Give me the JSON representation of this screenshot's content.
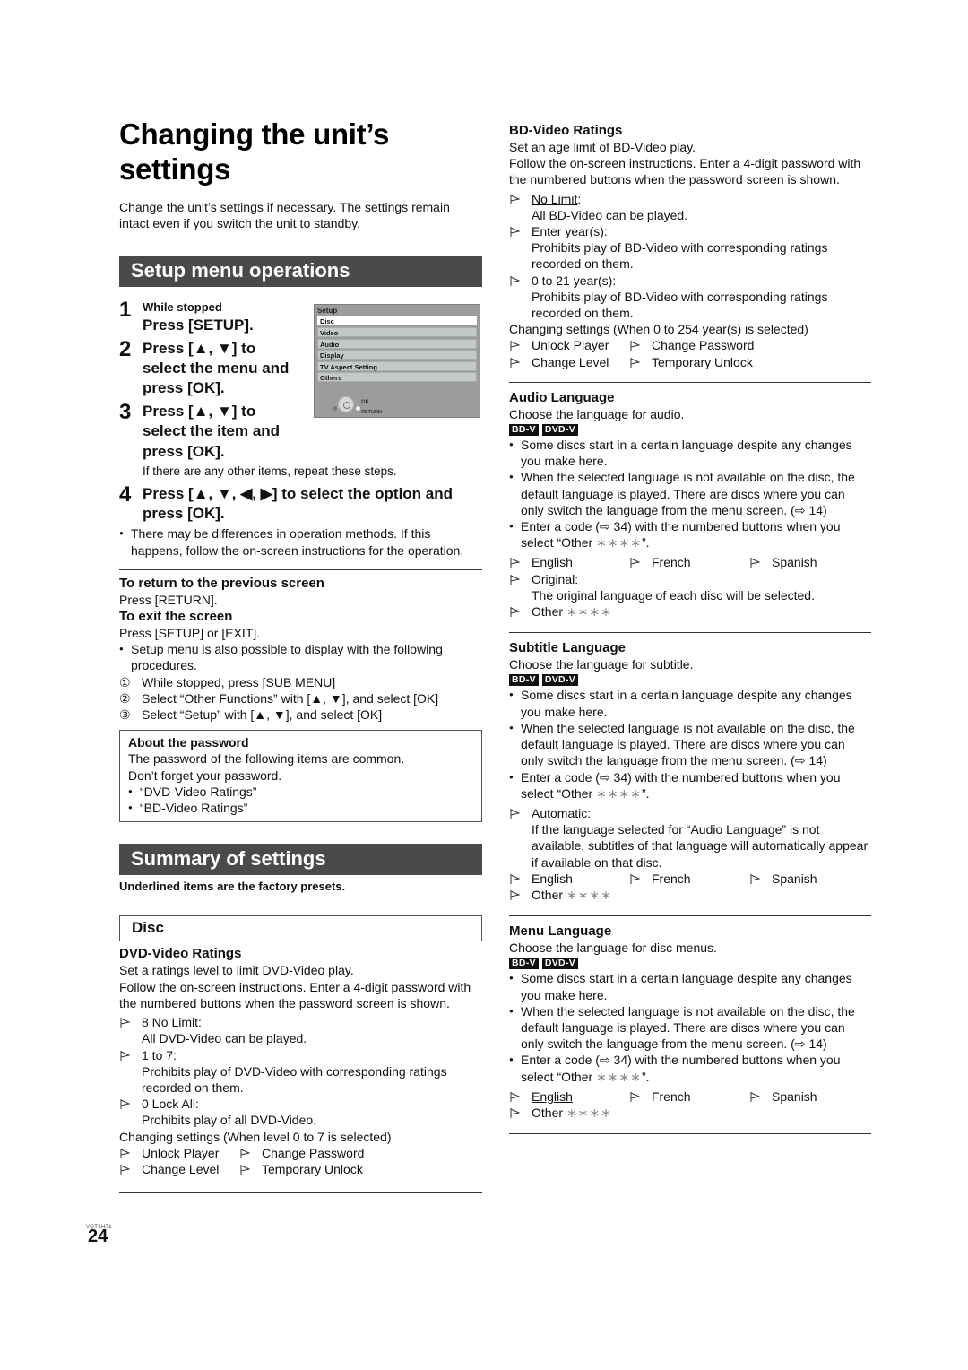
{
  "page": {
    "title_line1": "Changing the unit’s",
    "title_line2": "settings",
    "intro": "Change the unit’s settings if necessary. The settings remain intact even if you switch the unit to standby.",
    "doc_code": "VQT2H71",
    "page_number": "24"
  },
  "setup_ops": {
    "heading": "Setup menu operations",
    "step1": {
      "num": "1",
      "condition": "While stopped",
      "action": "Press [SETUP]."
    },
    "step2": {
      "num": "2",
      "line1": "Press [▲, ▼] to",
      "line2": "select the menu and",
      "line3": "press [OK]."
    },
    "step3": {
      "num": "3",
      "line1": "Press [▲, ▼] to",
      "line2": "select the item and",
      "line3": "press [OK].",
      "note": "If there are any other items, repeat these steps."
    },
    "step4": {
      "num": "4",
      "line1": "Press [▲, ▼, ◀, ▶] to select the option and",
      "line2": "press [OK].",
      "note": "There may be differences in operation methods. If this happens, follow the on-screen instructions for the operation."
    },
    "osd": {
      "title": "Setup",
      "items": [
        "Disc",
        "Video",
        "Audio",
        "Display",
        "TV Aspect Setting",
        "Others"
      ],
      "selected": "Disc",
      "ok_label": "OK",
      "return_label": "RETURN"
    },
    "return_heading": "To return to the previous screen",
    "return_text": "Press [RETURN].",
    "exit_heading": "To exit the screen",
    "exit_text": "Press [SETUP] or [EXIT].",
    "alt_note": "Setup menu is also possible to display with the following procedures.",
    "alt_steps": [
      {
        "mark": "①",
        "text": "While stopped, press [SUB MENU]"
      },
      {
        "mark": "②",
        "text": "Select “Other Functions” with [▲, ▼], and select [OK]"
      },
      {
        "mark": "③",
        "text": "Select “Setup” with [▲, ▼], and select [OK]"
      }
    ],
    "password_box": {
      "heading": "About the password",
      "line1": "The password of the following items are common.",
      "line2": "Don’t forget your password.",
      "items": [
        "“DVD-Video Ratings”",
        "“BD-Video Ratings”"
      ]
    }
  },
  "summary": {
    "heading": "Summary of settings",
    "note": "Underlined items are the factory presets.",
    "disc_heading": "Disc"
  },
  "dvd_ratings": {
    "heading": "DVD-Video Ratings",
    "desc1": "Set a ratings level to limit DVD-Video play.",
    "desc2": "Follow the on-screen instructions. Enter a 4-digit password with the numbered buttons when the password screen is shown.",
    "opt1": "8 No Limit",
    "opt1_desc": "All DVD-Video can be played.",
    "opt2": "1 to 7:",
    "opt2_desc": "Prohibits play of DVD-Video with corresponding ratings recorded on them.",
    "opt3": "0 Lock All:",
    "opt3_desc": "Prohibits play of all DVD-Video.",
    "changing": "Changing settings (When level 0 to 7 is selected)",
    "change_opts": [
      "Unlock Player",
      "Change Password",
      "Change Level",
      "Temporary Unlock"
    ]
  },
  "bd_ratings": {
    "heading": "BD-Video Ratings",
    "desc1": "Set an age limit of BD-Video play.",
    "desc2": "Follow the on-screen instructions. Enter a 4-digit password with the numbered buttons when the password screen is shown.",
    "opt1": "No Limit",
    "opt1_desc": "All BD-Video can be played.",
    "opt2": "Enter year(s):",
    "opt2_desc": "Prohibits play of BD-Video with corresponding ratings recorded on them.",
    "opt3": "0 to 21 year(s):",
    "opt3_desc": "Prohibits play of BD-Video with corresponding ratings recorded on them.",
    "changing": "Changing settings (When 0 to 254 year(s) is selected)",
    "change_opts": [
      "Unlock Player",
      "Change Password",
      "Change Level",
      "Temporary Unlock"
    ]
  },
  "badges": {
    "bd": "BD-V",
    "dvd": "DVD-V"
  },
  "common": {
    "bullet1": "Some discs start in a certain language despite any changes you make here.",
    "bullet2": "When the selected language is not available on the disc, the default language is played. There are discs where you can only switch the language from the menu screen. (⇨ 14)",
    "bullet3_pre": "Enter a code (⇨ 34) with the numbered buttons when you select “Other ",
    "stars": "∗∗∗∗",
    "bullet3_post": "”.",
    "other": "Other ",
    "english": "English",
    "french": "French",
    "spanish": "Spanish"
  },
  "audio_lang": {
    "heading": "Audio Language",
    "desc": "Choose the language for audio.",
    "original": "Original:",
    "original_desc": "The original language of each disc will be selected."
  },
  "subtitle_lang": {
    "heading": "Subtitle Language",
    "desc": "Choose the language for subtitle.",
    "automatic": "Automatic",
    "automatic_desc": "If the language selected for “Audio Language” is not available, subtitles of that language will automatically appear if available on that disc."
  },
  "menu_lang": {
    "heading": "Menu Language",
    "desc": "Choose the language for disc menus."
  }
}
